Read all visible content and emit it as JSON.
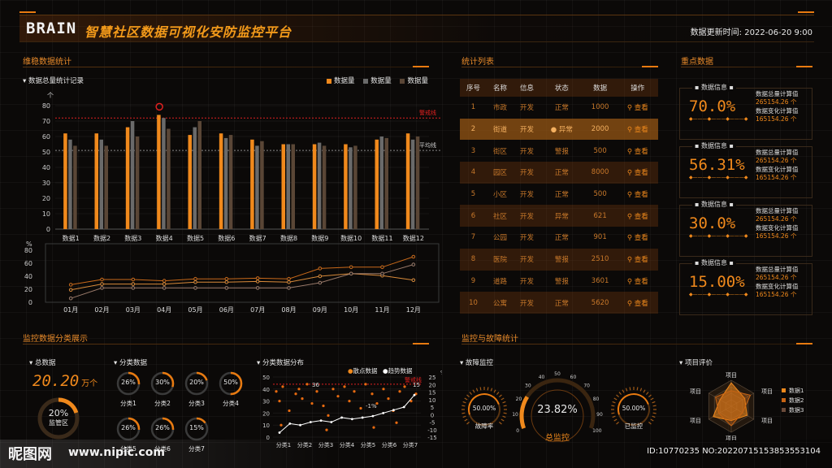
{
  "header": {
    "logo": "BRAIN",
    "title": "智慧社区数据可视化安防监控平台",
    "update_label": "数据更新时间:",
    "update_time": "2022-06-20  9:00"
  },
  "colors": {
    "orange": "#f0891c",
    "gray": "#6a6a6a",
    "brown": "#5a4636",
    "alert": "#e02020"
  },
  "stability": {
    "title": "维稳数据统计",
    "subtitle": "数据总量统计记录",
    "legend": [
      "数据量",
      "数据量",
      "数据量"
    ],
    "alert_label": "警戒线",
    "avg_label": "平均线",
    "y_unit": "个",
    "chart_data": {
      "type": "bar",
      "categories": [
        "数据1",
        "数据2",
        "数据3",
        "数据4",
        "数据5",
        "数据6",
        "数据7",
        "数据8",
        "数据9",
        "数据10",
        "数据11",
        "数据12"
      ],
      "series": [
        {
          "name": "数据量",
          "values": [
            62,
            62,
            66,
            74,
            61,
            62,
            58,
            55,
            55,
            55,
            58,
            62
          ]
        },
        {
          "name": "数据量",
          "values": [
            58,
            58,
            70,
            72,
            66,
            59,
            54,
            55,
            56,
            53,
            60,
            58
          ]
        },
        {
          "name": "数据量",
          "values": [
            54,
            54,
            60,
            65,
            70,
            61,
            57,
            55,
            54,
            54,
            59,
            60
          ]
        }
      ],
      "ylim": [
        0,
        80
      ],
      "yticks": [
        0,
        10,
        20,
        30,
        40,
        50,
        60,
        70,
        80
      ],
      "alert_value": 72,
      "avg_value": 51
    },
    "line_chart": {
      "type": "line",
      "y_unit": "%",
      "categories": [
        "01月",
        "02月",
        "03月",
        "04月",
        "05月",
        "06月",
        "07月",
        "08月",
        "09月",
        "10月",
        "11月",
        "12月"
      ],
      "series": [
        {
          "name": "",
          "values": [
            27,
            35,
            35,
            33,
            36,
            36,
            37,
            36,
            52,
            54,
            54,
            70
          ]
        },
        {
          "name": "",
          "values": [
            19,
            28,
            28,
            28,
            31,
            31,
            32,
            31,
            40,
            44,
            41,
            34
          ]
        },
        {
          "name": "",
          "values": [
            6,
            22,
            22,
            22,
            22,
            22,
            22,
            22,
            30,
            44,
            44,
            58
          ]
        }
      ],
      "ylim": [
        0,
        80
      ],
      "yticks": [
        0,
        20,
        40,
        60,
        80
      ]
    }
  },
  "stat_list": {
    "title": "统计列表",
    "headers": [
      "序号",
      "名称",
      "信息",
      "状态",
      "数据",
      "操作"
    ],
    "rows": [
      [
        "1",
        "市政",
        "开发",
        "正常",
        "1000",
        "查看"
      ],
      [
        "2",
        "街道",
        "开发",
        "异常",
        "2000",
        "查看"
      ],
      [
        "3",
        "街区",
        "开发",
        "警报",
        "500",
        "查看"
      ],
      [
        "4",
        "园区",
        "开发",
        "正常",
        "8000",
        "查看"
      ],
      [
        "5",
        "小区",
        "开发",
        "正常",
        "500",
        "查看"
      ],
      [
        "6",
        "社区",
        "开发",
        "异常",
        "621",
        "查看"
      ],
      [
        "7",
        "公园",
        "开发",
        "正常",
        "901",
        "查看"
      ],
      [
        "8",
        "医院",
        "开发",
        "警报",
        "2510",
        "查看"
      ],
      [
        "9",
        "道路",
        "开发",
        "警报",
        "3601",
        "查看"
      ],
      [
        "10",
        "公寓",
        "开发",
        "正常",
        "5620",
        "查看"
      ]
    ]
  },
  "key_data": {
    "title": "重点数据",
    "cards": [
      {
        "tag": "数据信息",
        "value": "70.0%",
        "lbl1": "数据总量计算值",
        "num1": "265154.26 个",
        "lbl2": "数据变化计算值",
        "num2": "165154.26 个"
      },
      {
        "tag": "数据信息",
        "value": "56.31%",
        "lbl1": "数据总量计算值",
        "num1": "265154.26 个",
        "lbl2": "数据变化计算值",
        "num2": "165154.26 个"
      },
      {
        "tag": "数据信息",
        "value": "30.0%",
        "lbl1": "数据总量计算值",
        "num1": "265154.26 个",
        "lbl2": "数据变化计算值",
        "num2": "165154.26 个"
      },
      {
        "tag": "数据信息",
        "value": "15.00%",
        "lbl1": "数据总量计算值",
        "num1": "265154.26 个",
        "lbl2": "数据变化计算值",
        "num2": "165154.26 个"
      }
    ]
  },
  "monitor": {
    "title": "监控数据分类展示",
    "total_label": "总数据",
    "total_value": "20.20",
    "total_unit": "万个",
    "ring_value": "20%",
    "ring_fraction": 0.2,
    "ring_label": "监管区",
    "class_title": "分类数据",
    "classes": [
      {
        "value": "26%",
        "label": "分类1",
        "fraction": 0.26
      },
      {
        "value": "30%",
        "label": "分类2",
        "fraction": 0.3
      },
      {
        "value": "20%",
        "label": "分类3",
        "fraction": 0.2
      },
      {
        "value": "50%",
        "label": "分类4",
        "fraction": 0.5
      },
      {
        "value": "26%",
        "label": "分类5",
        "fraction": 0.26
      },
      {
        "value": "26%",
        "label": "分类6",
        "fraction": 0.26
      },
      {
        "value": "15%",
        "label": "分类7",
        "fraction": 0.15
      }
    ],
    "dist_title": "分类数据分布",
    "dist_legend": [
      "散点数据",
      "趋势数据"
    ],
    "dist_alert": "警戒线",
    "dist_chart": {
      "type": "scatter",
      "categories": [
        "分类1",
        "分类2",
        "分类3",
        "分类4",
        "分类5",
        "分类6",
        "分类7"
      ],
      "y_left": [
        0,
        10,
        20,
        30,
        40,
        50
      ],
      "y_right": [
        "-15",
        "-10",
        "-5",
        "0",
        "5",
        "10",
        "15",
        "20",
        "25"
      ],
      "right_unit": "%",
      "trend": [
        -12,
        -6,
        -7,
        -5,
        -4,
        -5,
        -2,
        -3,
        -2,
        -1,
        1,
        3,
        5,
        13
      ],
      "labels": [
        "36",
        "-1%",
        "15"
      ]
    }
  },
  "fault": {
    "title": "监控与故障统计",
    "sub": "故障监控",
    "left_value": "50.00%",
    "left_label": "故障率",
    "main_value": "23.82%",
    "main_label": "总监控",
    "right_value": "50.00%",
    "right_label": "已监控",
    "main_fraction": 0.2382,
    "ticks": [
      "0",
      "10",
      "20",
      "30",
      "40",
      "50",
      "60",
      "70",
      "80",
      "90",
      "100"
    ]
  },
  "evaluation": {
    "title": "项目评价",
    "axis_label": "项目",
    "legend": [
      "数据1",
      "数据2",
      "数据3"
    ]
  },
  "watermark": {
    "logo": "昵图网",
    "url": "www.nipic.com",
    "id": "ID:10770235 NO:20220715153853553104"
  }
}
